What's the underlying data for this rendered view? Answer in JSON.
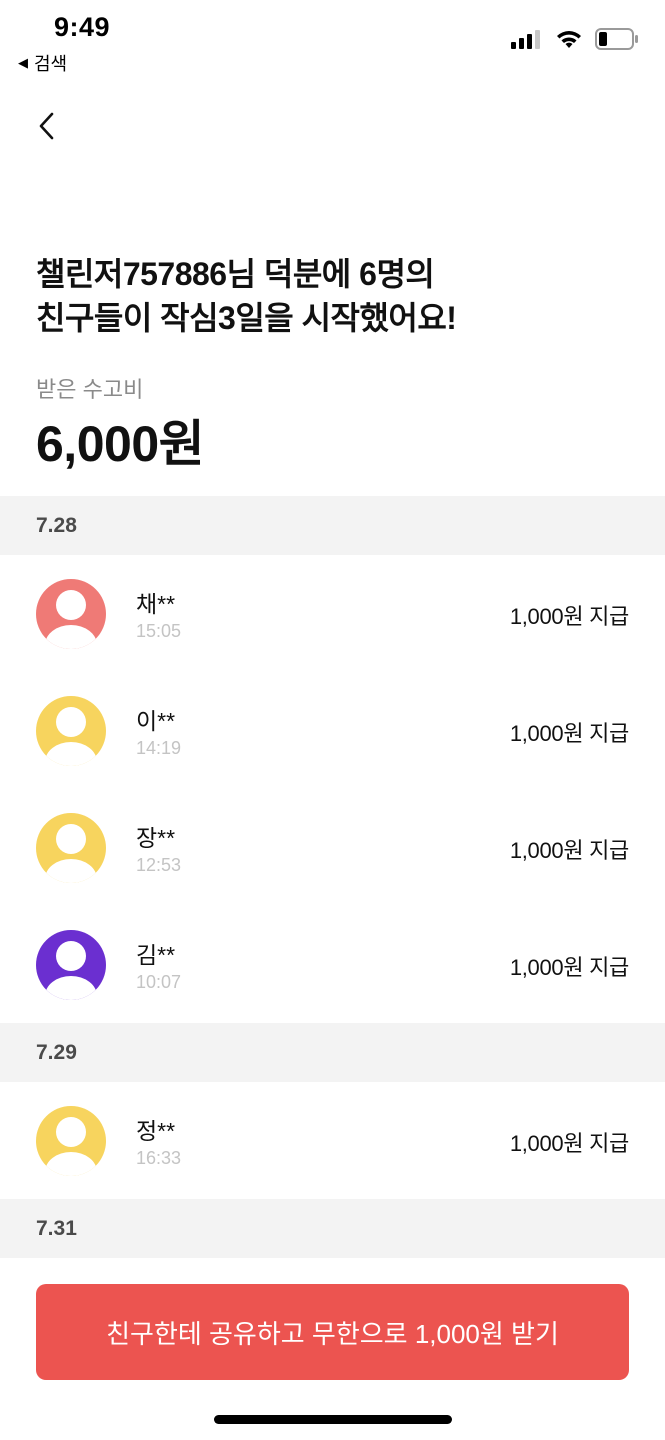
{
  "status_bar": {
    "time": "9:49",
    "back_app": "검색",
    "icons": [
      "cellular-signal-icon",
      "wifi-icon",
      "battery-icon"
    ]
  },
  "nav": {
    "back_icon": "chevron-left-icon"
  },
  "headline": {
    "line1": "챌린저757886님 덕분에 6명의",
    "line2": "친구들이 작심3일을 시작했어요!"
  },
  "earnings": {
    "label": "받은 수고비",
    "amount": "6,000원"
  },
  "groups": [
    {
      "date": "7.28",
      "entries": [
        {
          "name": "채**",
          "time": "15:05",
          "amount": "1,000원 지급",
          "avatar_color": "#ef7a76"
        },
        {
          "name": "이**",
          "time": "14:19",
          "amount": "1,000원 지급",
          "avatar_color": "#f7d45e"
        },
        {
          "name": "장**",
          "time": "12:53",
          "amount": "1,000원 지급",
          "avatar_color": "#f7d45e"
        },
        {
          "name": "김**",
          "time": "10:07",
          "amount": "1,000원 지급",
          "avatar_color": "#6b2fd0"
        }
      ]
    },
    {
      "date": "7.29",
      "entries": [
        {
          "name": "정**",
          "time": "16:33",
          "amount": "1,000원 지급",
          "avatar_color": "#f7d45e"
        }
      ]
    },
    {
      "date": "7.31",
      "entries": []
    }
  ],
  "cta": {
    "label": "친구한테 공유하고 무한으로 1,000원 받기",
    "color": "#ec5450"
  }
}
